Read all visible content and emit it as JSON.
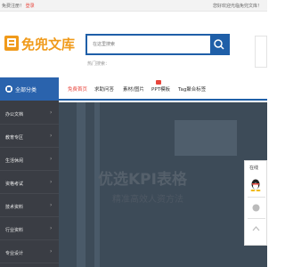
{
  "topbar": {
    "greeting": "免费注册！",
    "login_label": "登录",
    "sep": "|",
    "register_label": "免费注册",
    "links": "您好欢迎光临免兜文库！"
  },
  "header": {
    "logo_text": "免兜文库",
    "search_placeholder": "在这里搜索",
    "hot_label": "热门搜索："
  },
  "nav": {
    "category_label": "全部分类",
    "items": [
      {
        "label": "免费首页",
        "active": true
      },
      {
        "label": "求助问答",
        "active": false
      },
      {
        "label": "素材/图片",
        "active": false
      },
      {
        "label": "PPT模板",
        "active": false
      },
      {
        "label": "Tag聚合标签",
        "active": false
      }
    ]
  },
  "sidebar": {
    "items": [
      {
        "label": "办公文档"
      },
      {
        "label": "教育专区"
      },
      {
        "label": "生活休闲"
      },
      {
        "label": "资格考试"
      },
      {
        "label": "技术资料"
      },
      {
        "label": "行业资料"
      },
      {
        "label": "专业设计"
      }
    ]
  },
  "banner": {
    "title": "优选KPI表格",
    "subtitle": "精准高效人资方法"
  },
  "float_panel": {
    "label": "在线"
  },
  "colors": {
    "brand_blue": "#1f5fa8",
    "accent_red": "#e8453c",
    "logo_orange": "#f09a1a",
    "sidebar_bg": "#3a3d44"
  }
}
